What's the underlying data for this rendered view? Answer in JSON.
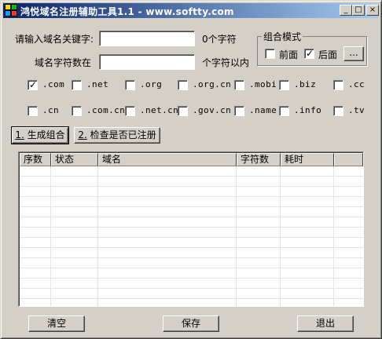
{
  "window": {
    "title": "鸿悦域名注册辅助工具1.1 - www.softty.com",
    "minimize": "_",
    "maximize": "□",
    "close": "×"
  },
  "form": {
    "keyword_label": "请输入域名关键字:",
    "keyword_value": "",
    "keyword_suffix": "0个字符",
    "length_label": "域名字符数在",
    "length_value": "",
    "length_suffix": "个字符以内"
  },
  "combo": {
    "title": "组合模式",
    "front_label": "前面",
    "front_checked": false,
    "back_label": "后面",
    "back_checked": true,
    "more_button": "..."
  },
  "tlds": [
    {
      "label": ".com",
      "checked": true
    },
    {
      "label": ".net",
      "checked": false
    },
    {
      "label": ".org",
      "checked": false
    },
    {
      "label": ".org.cn",
      "checked": false
    },
    {
      "label": ".mobi",
      "checked": false
    },
    {
      "label": ".biz",
      "checked": false
    },
    {
      "label": ".cc",
      "checked": false
    },
    {
      "label": ".cn",
      "checked": false
    },
    {
      "label": ".com.cn",
      "checked": false
    },
    {
      "label": ".net.cn",
      "checked": false
    },
    {
      "label": ".gov.cn",
      "checked": false
    },
    {
      "label": ".name",
      "checked": false
    },
    {
      "label": ".info",
      "checked": false
    },
    {
      "label": ".tv",
      "checked": false
    }
  ],
  "actions": {
    "generate_key": "1.",
    "generate_text": " 生成组合",
    "check_key": "2.",
    "check_text": " 检查是否已注册"
  },
  "table": {
    "columns": [
      "序数",
      "状态",
      "域名",
      "字符数",
      "耗时",
      ""
    ],
    "rows": []
  },
  "footer": {
    "clear": "清空",
    "save": "保存",
    "exit": "退出"
  },
  "colors": {
    "title_start": "#0a246a",
    "title_end": "#a6caf0",
    "face": "#d4d0c8"
  }
}
